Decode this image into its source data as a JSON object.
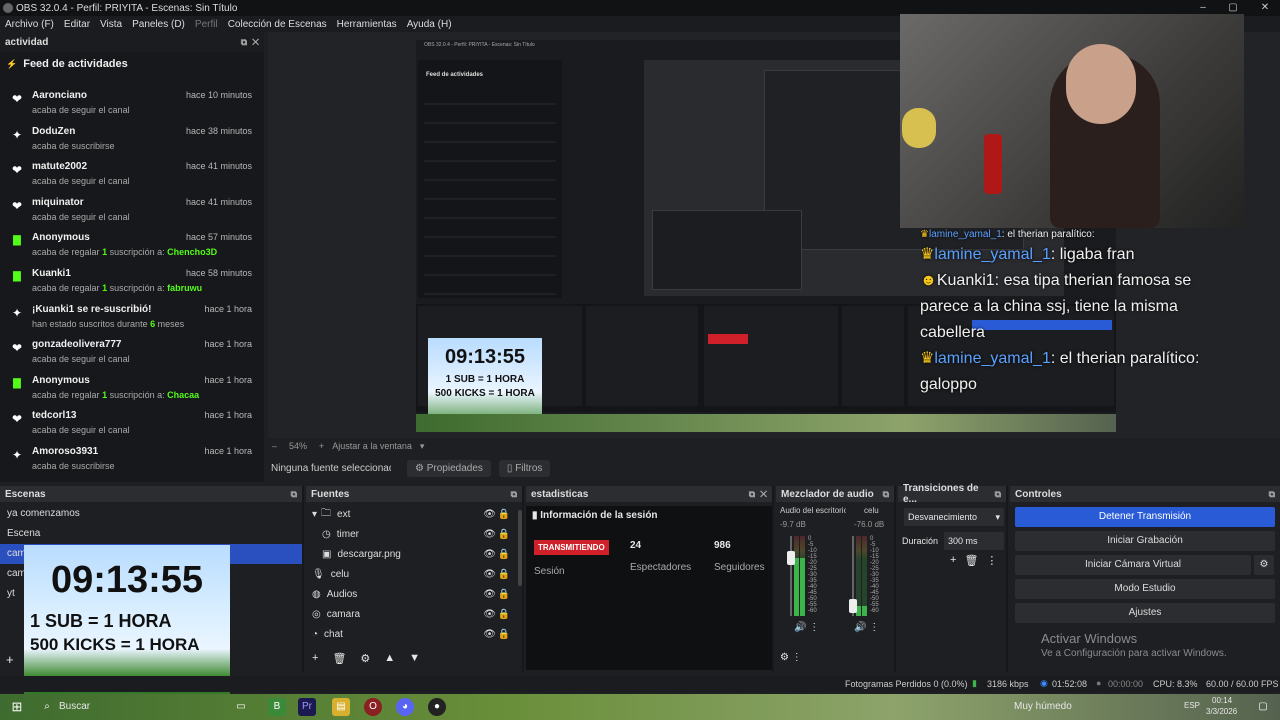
{
  "window": {
    "title": "OBS 32.0.4 - Perfil: PRIYITA - Escenas: Sin Título",
    "min": "–",
    "max": "▢",
    "close": "✕"
  },
  "menu": [
    "Archivo (F)",
    "Editar",
    "Vista",
    "Paneles (D)",
    "Perfil",
    "Colección de Escenas",
    "Herramientas",
    "Ayuda (H)"
  ],
  "activity": {
    "dock_title": "actividad",
    "feed_title": "Feed de actividades",
    "items": [
      {
        "icon": "heart",
        "name": "Aaronciano",
        "time": "hace 10 minutos",
        "desc": "acaba de seguir el canal"
      },
      {
        "icon": "sparkle",
        "name": "DoduZen",
        "time": "hace 38 minutos",
        "desc": "acaba de suscribirse"
      },
      {
        "icon": "heart",
        "name": "matute2002",
        "time": "hace 41 minutos",
        "desc": "acaba de seguir el canal"
      },
      {
        "icon": "heart",
        "name": "miquinator",
        "time": "hace 41 minutos",
        "desc": "acaba de seguir el canal"
      },
      {
        "icon": "gift",
        "name": "Anonymous",
        "time": "hace 57 minutos",
        "desc": "acaba de regalar ",
        "hl1": "1",
        "mid": " suscripción a: ",
        "hl2": "Chencho3D"
      },
      {
        "icon": "gift",
        "name": "Kuanki1",
        "time": "hace 58 minutos",
        "desc": "acaba de regalar ",
        "hl1": "1",
        "mid": " suscripción a: ",
        "hl2": "fabruwu"
      },
      {
        "icon": "sparkle",
        "name": "¡Kuanki1 se re-suscribió!",
        "time": "hace 1 hora",
        "desc": "han estado suscritos durante ",
        "hl1": "6",
        "mid": " meses",
        "hl2": ""
      },
      {
        "icon": "heart",
        "name": "gonzadeolivera777",
        "time": "hace 1 hora",
        "desc": "acaba de seguir el canal"
      },
      {
        "icon": "gift",
        "name": "Anonymous",
        "time": "hace 1 hora",
        "desc": "acaba de regalar ",
        "hl1": "1",
        "mid": " suscripción a: ",
        "hl2": "Chacaa"
      },
      {
        "icon": "heart",
        "name": "tedcorl13",
        "time": "hace 1 hora",
        "desc": "acaba de seguir el canal"
      },
      {
        "icon": "sparkle",
        "name": "Amoroso3931",
        "time": "hace 1 hora",
        "desc": "acaba de suscribirse"
      }
    ]
  },
  "chat": {
    "lines": [
      {
        "user": "lamine_yamal_1",
        "text": ": el therian paralítico:",
        "small": true
      },
      {
        "user": "lamine_yamal_1",
        "text": ": ligaba fran"
      },
      {
        "user": "Kuanki1",
        "text": ": esa tipa therian famosa se parece a la china ssj, tiene la misma cabellera"
      },
      {
        "user": "lamine_yamal_1",
        "text": ": el therian paralítico: galoppo"
      }
    ]
  },
  "nested": {
    "title": "OBS 32.0.4 - Perfil: PRIYITA - Escenas: Sin Título",
    "feed": "Feed de actividades"
  },
  "zoom": {
    "value": "54%",
    "fit": "Ajustar a la ventana",
    "minus": "–",
    "plus": "+"
  },
  "source_bar": {
    "none": "Ninguna fuente seleccionada",
    "props": "Propiedades",
    "filters": "Filtros"
  },
  "scenes": {
    "title": "Escenas",
    "items": [
      "ya comenzamos",
      "Escena",
      "camara",
      "camara",
      "yt"
    ],
    "selected": 2
  },
  "sources": {
    "title": "Fuentes",
    "items": [
      {
        "icon": "folder",
        "label": "ext",
        "indent": 0
      },
      {
        "icon": "clock",
        "label": "timer",
        "indent": 1
      },
      {
        "icon": "image",
        "label": "descargar.png",
        "indent": 1
      },
      {
        "icon": "mic",
        "label": "celu",
        "indent": 0
      },
      {
        "icon": "audio",
        "label": "Audios",
        "indent": 0
      },
      {
        "icon": "camera",
        "label": "camara",
        "indent": 0
      },
      {
        "icon": "chat",
        "label": "chat",
        "indent": 0
      }
    ]
  },
  "stats": {
    "title": "estadisticas",
    "info": "Información de la sesión",
    "live": "TRANSMITIENDO",
    "session": "Sesión",
    "viewers": "24",
    "viewers_label": "Espectadores",
    "followers": "986",
    "followers_label": "Seguidores"
  },
  "mixer": {
    "title": "Mezclador de audio",
    "ch1": {
      "name": "Audio del escritorio",
      "db": "-9.7 dB",
      "level": 0.72
    },
    "ch2": {
      "name": "celu",
      "db": "-76.0 dB",
      "level": 0.12
    },
    "ticks": [
      "0",
      "-5",
      "-10",
      "-15",
      "-20",
      "-25",
      "-30",
      "-35",
      "-40",
      "-45",
      "-50",
      "-55",
      "-60"
    ]
  },
  "transitions": {
    "title": "Transiciones de e...",
    "selected": "Desvanecimiento",
    "duration_label": "Duración",
    "duration": "300 ms"
  },
  "controls": {
    "title": "Controles",
    "buttons": [
      "Detener Transmisión",
      "Iniciar Grabación",
      "Iniciar Cámara Virtual",
      "Modo Estudio",
      "Ajustes"
    ]
  },
  "timer": {
    "time": "09:13:55",
    "line1": "1 SUB = 1 HORA",
    "line2": "500 KICKS = 1 HORA"
  },
  "activate": {
    "title": "Activar Windows",
    "sub": "Ve a Configuración para activar Windows."
  },
  "status": {
    "dropped": "Fotogramas Perdidos 0 (0.0%)",
    "kbps": "3186 kbps",
    "stream_time": "01:52:08",
    "rec_time": "00:00:00",
    "cpu": "CPU: 8.3%",
    "fps": "60.00 / 60.00 FPS"
  },
  "taskbar": {
    "search": "Buscar",
    "weather": "Muy húmedo",
    "lang": "ESP",
    "time": "00:14",
    "date": "3/3/2026"
  },
  "colors": {
    "accent": "#2a5bd7",
    "kick_green": "#53fc18",
    "live_red": "#d0202a"
  }
}
